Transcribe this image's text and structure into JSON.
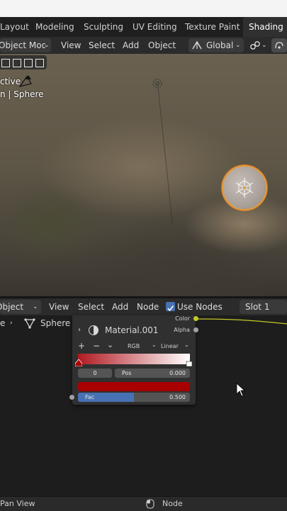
{
  "workspace_tabs": [
    {
      "label": "Layout",
      "active": false
    },
    {
      "label": "Modeling",
      "active": false
    },
    {
      "label": "Sculpting",
      "active": false
    },
    {
      "label": "UV Editing",
      "active": false
    },
    {
      "label": "Texture Paint",
      "active": false
    },
    {
      "label": "Shading",
      "active": true
    }
  ],
  "viewport_header": {
    "mode": "Object Mode",
    "menus": [
      "View",
      "Select",
      "Add",
      "Object"
    ],
    "transform_orientation": "Global"
  },
  "viewport": {
    "overlay_line1": "ctive",
    "overlay_line2": "n | Sphere"
  },
  "node_header": {
    "editor_type": "Object",
    "menus": [
      "View",
      "Select",
      "Add",
      "Node"
    ],
    "use_nodes_label": "Use Nodes",
    "use_nodes_checked": true,
    "slot": "Slot 1"
  },
  "breadcrumb": {
    "prefix": "e",
    "object": "Sphere",
    "material": "Material.001"
  },
  "color_ramp_node": {
    "outputs": [
      "Color",
      "Alpha"
    ],
    "color_mode": "RGB",
    "interpolation": "Linear",
    "stop_index": "0",
    "pos_label": "Pos",
    "pos_value": "0.000",
    "fac_label": "Fac",
    "fac_value": "0.500",
    "fac_fraction": 0.5,
    "ramp_start_color": "#b01a22",
    "stop_color": "#a80000"
  },
  "status_bar": {
    "left": "Pan View",
    "center": "Node"
  },
  "colors": {
    "accent_blue": "#4772b3",
    "selection_orange": "#e59a3a",
    "socket_yellow": "#c7c729",
    "socket_gray": "#a1a1a1"
  }
}
